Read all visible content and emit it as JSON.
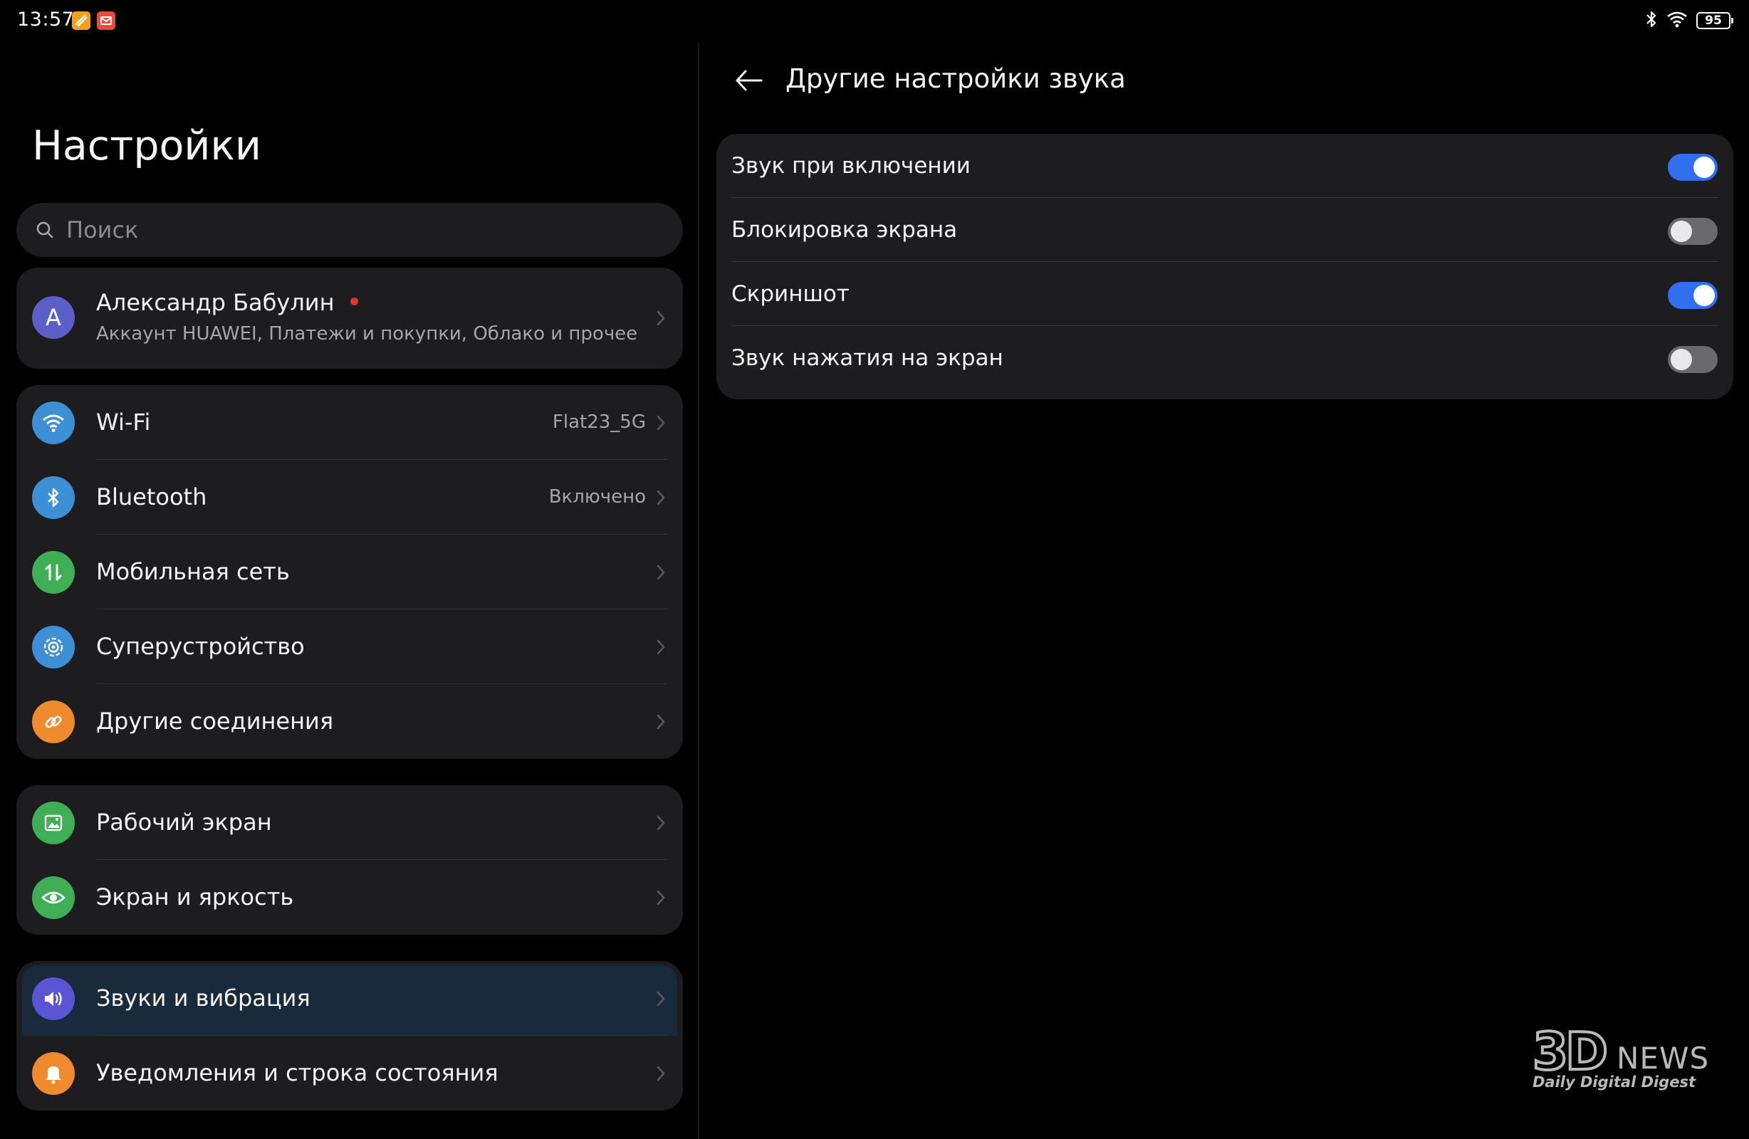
{
  "status_bar": {
    "time": "13:57",
    "battery": "95",
    "icons": [
      "bluetooth-icon",
      "wifi-icon",
      "battery-icon"
    ]
  },
  "left": {
    "title": "Настройки",
    "search": {
      "placeholder": "Поиск",
      "icon": "search-icon"
    },
    "account": {
      "avatar_letter": "A",
      "name": "Александр Бабулин",
      "subtitle": "Аккаунт HUAWEI, Платежи и покупки, Облако и прочее"
    },
    "connections": [
      {
        "label": "Wi-Fi",
        "value": "Flat23_5G",
        "icon": "wifi-icon",
        "color": "#3d8fd6"
      },
      {
        "label": "Bluetooth",
        "value": "Включено",
        "icon": "bluetooth-icon",
        "color": "#3d8fd6"
      },
      {
        "label": "Мобильная сеть",
        "value": "",
        "icon": "mobile-data-icon",
        "color": "#3fae55"
      },
      {
        "label": "Суперустройство",
        "value": "",
        "icon": "super-device-icon",
        "color": "#3d8fd6"
      },
      {
        "label": "Другие соединения",
        "value": "",
        "icon": "link-icon",
        "color": "#ef8a2e"
      }
    ],
    "display": [
      {
        "label": "Рабочий экран",
        "icon": "wallpaper-icon",
        "color": "#3fae55"
      },
      {
        "label": "Экран и яркость",
        "icon": "eye-icon",
        "color": "#3fae55"
      }
    ],
    "sound": [
      {
        "label": "Звуки и вибрация",
        "icon": "volume-icon",
        "color": "#5b55d6",
        "selected": true
      },
      {
        "label": "Уведомления и строка состояния",
        "icon": "bell-icon",
        "color": "#ef8a2e"
      }
    ]
  },
  "right": {
    "title": "Другие настройки звука",
    "toggles": [
      {
        "label": "Звук при включении",
        "on": true
      },
      {
        "label": "Блокировка экрана",
        "on": false
      },
      {
        "label": "Скриншот",
        "on": true
      },
      {
        "label": "Звук нажатия на экран",
        "on": false
      }
    ]
  },
  "watermark": {
    "logo": "3D",
    "brand": "NEWS",
    "tagline": "Daily Digital Digest"
  },
  "colors": {
    "background": "#000000",
    "card": "#1d1d1f",
    "accent_blue": "#2f6ff0",
    "selected_row": "#1a2a3d"
  }
}
